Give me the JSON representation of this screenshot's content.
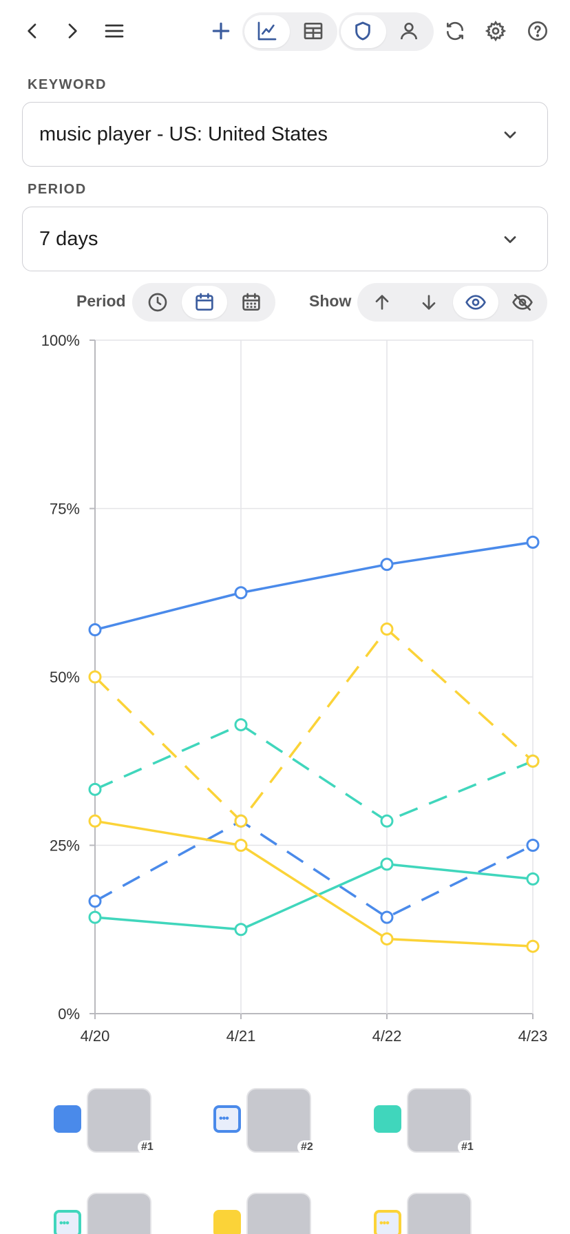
{
  "toolbar": {
    "icons": [
      "back-icon",
      "forward-icon",
      "menu-icon",
      "add-icon",
      "chart-icon",
      "table-icon",
      "shield-icon",
      "user-icon",
      "refresh-icon",
      "settings-icon",
      "help-icon"
    ]
  },
  "keyword": {
    "label": "KEYWORD",
    "value": "music player - US: United States"
  },
  "period_field": {
    "label": "PERIOD",
    "value": "7 days"
  },
  "controls": {
    "period_label": "Period",
    "show_label": "Show"
  },
  "colors": {
    "blue": "#4a8aea",
    "teal": "#40d6bc",
    "yellow": "#fbd338",
    "accent": "#3b5c9e"
  },
  "chart_data": {
    "type": "line",
    "x": [
      "4/20",
      "4/21",
      "4/22",
      "4/23"
    ],
    "y_ticks": [
      "100%",
      "75%",
      "50%",
      "25%",
      "0%"
    ],
    "ylim": [
      0,
      100
    ],
    "grid": true,
    "series": [
      {
        "color": "#4a8aea",
        "dash": false,
        "values": [
          57,
          62.5,
          66.7,
          70
        ]
      },
      {
        "color": "#4a8aea",
        "dash": true,
        "values": [
          16.7,
          28.6,
          14.3,
          25
        ]
      },
      {
        "color": "#40d6bc",
        "dash": false,
        "values": [
          14.3,
          12.5,
          22.2,
          20
        ]
      },
      {
        "color": "#40d6bc",
        "dash": true,
        "values": [
          33.3,
          42.9,
          28.6,
          37.5
        ]
      },
      {
        "color": "#fbd338",
        "dash": false,
        "values": [
          28.6,
          25,
          11.1,
          10
        ]
      },
      {
        "color": "#fbd338",
        "dash": true,
        "values": [
          50,
          28.6,
          57.1,
          37.5
        ]
      }
    ]
  },
  "legend": [
    {
      "color": "#4a8aea",
      "style": "solid",
      "rank": "#1"
    },
    {
      "color": "#4a8aea",
      "style": "dashed",
      "rank": "#2"
    },
    {
      "color": "#40d6bc",
      "style": "solid",
      "rank": "#1"
    },
    {
      "color": "#40d6bc",
      "style": "dashed",
      "rank": ""
    },
    {
      "color": "#fbd338",
      "style": "solid",
      "rank": ""
    },
    {
      "color": "#fbd338",
      "style": "dashed",
      "rank": ""
    }
  ]
}
